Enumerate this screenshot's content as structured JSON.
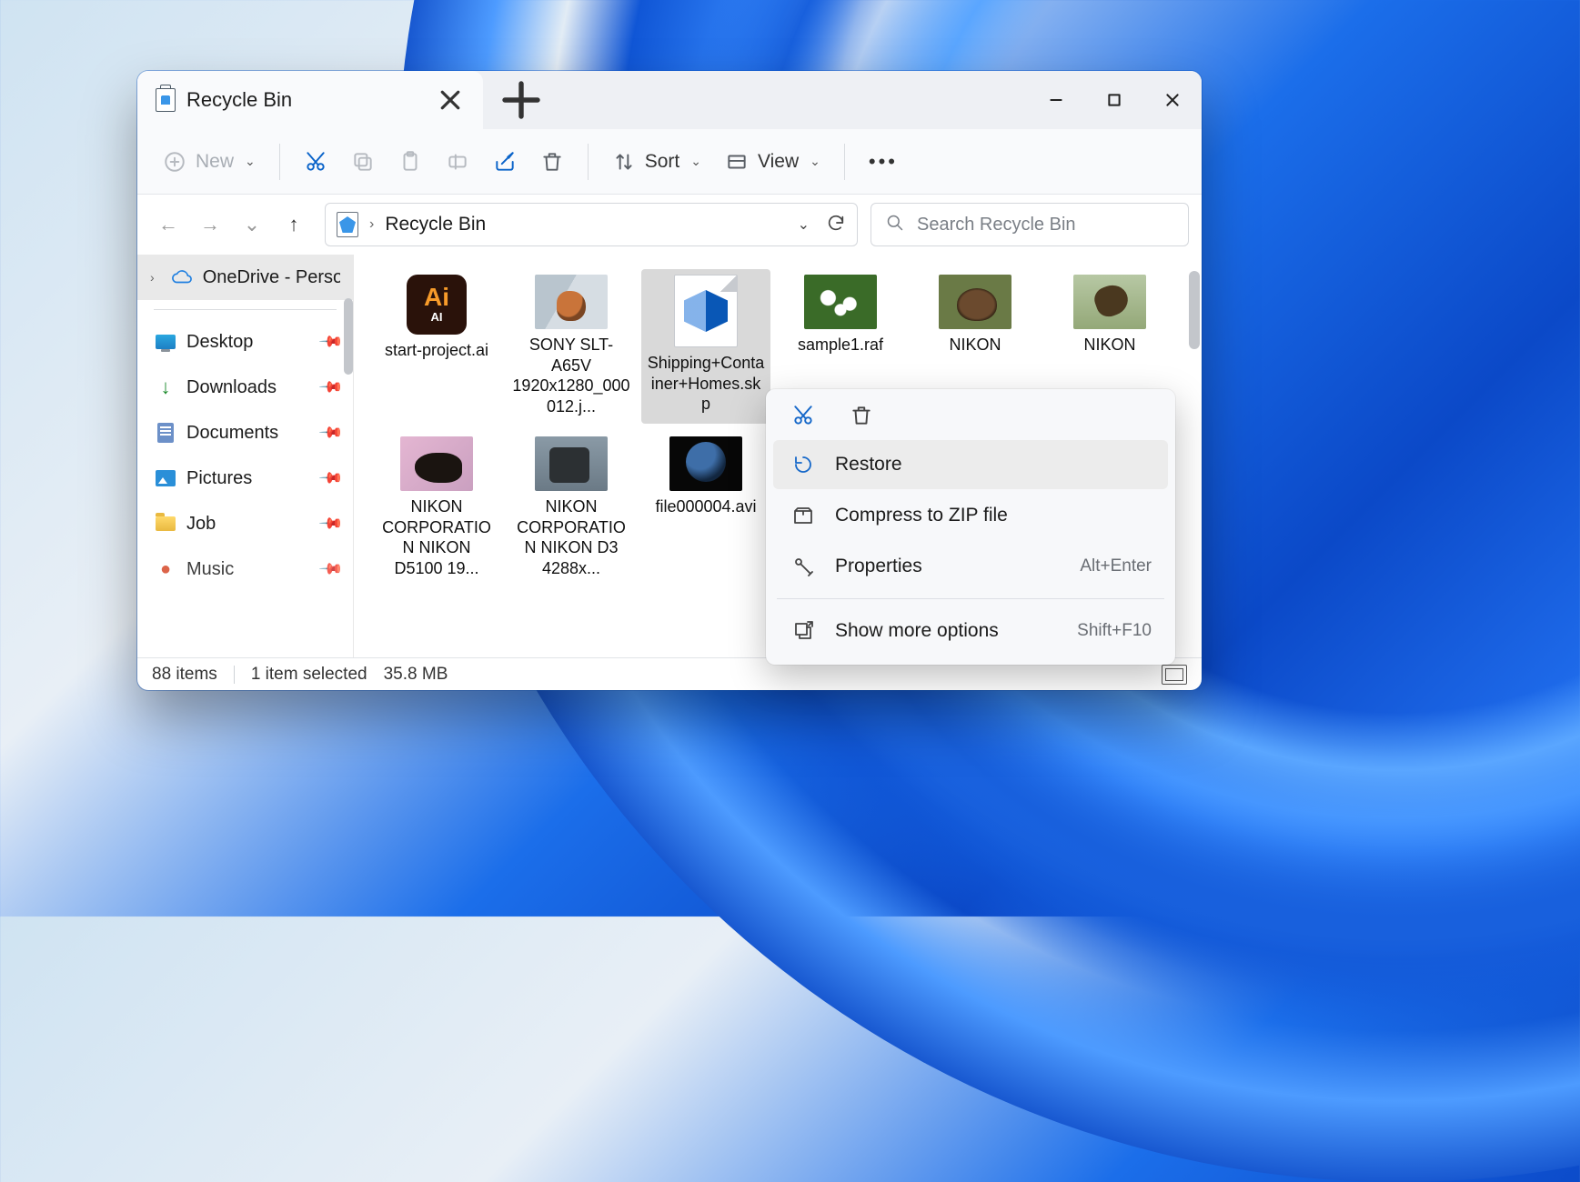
{
  "tab": {
    "title": "Recycle Bin"
  },
  "toolbar": {
    "new": "New",
    "sort": "Sort",
    "view": "View"
  },
  "breadcrumb": {
    "location": "Recycle Bin"
  },
  "search": {
    "placeholder": "Search Recycle Bin"
  },
  "sidebar": {
    "onedrive": "OneDrive - Personal",
    "items": [
      {
        "label": "Desktop"
      },
      {
        "label": "Downloads"
      },
      {
        "label": "Documents"
      },
      {
        "label": "Pictures"
      },
      {
        "label": "Job"
      },
      {
        "label": "Music"
      }
    ]
  },
  "files": [
    {
      "name": "start-project.ai"
    },
    {
      "name": "SONY SLT-A65V 1920x1280_000012.j..."
    },
    {
      "name": "Shipping+Container+Homes.skp"
    },
    {
      "name": "sample1.raf"
    },
    {
      "name": "NIKON"
    },
    {
      "name": "NIKON"
    },
    {
      "name": "NIKON CORPORATION NIKON D5100 19..."
    },
    {
      "name": "NIKON CORPORATION NIKON D3 4288x..."
    },
    {
      "name": "file000004.avi"
    }
  ],
  "status": {
    "count": "88 items",
    "selection": "1 item selected",
    "size": "35.8 MB"
  },
  "context": {
    "restore": "Restore",
    "zip": "Compress to ZIP file",
    "properties": "Properties",
    "properties_shortcut": "Alt+Enter",
    "more": "Show more options",
    "more_shortcut": "Shift+F10"
  }
}
